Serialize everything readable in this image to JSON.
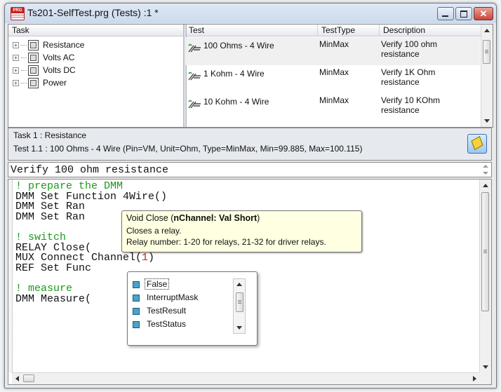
{
  "window": {
    "title": "Ts201-SelfTest.prg (Tests) :1 *",
    "app_icon_label": "PRG",
    "close_glyph": "✕"
  },
  "task_pane": {
    "header": "Task",
    "items": [
      {
        "label": "Resistance",
        "expander": "+"
      },
      {
        "label": "Volts AC",
        "expander": "+"
      },
      {
        "label": "Volts DC",
        "expander": "+"
      },
      {
        "label": "Power",
        "expander": "+"
      }
    ]
  },
  "test_pane": {
    "headers": {
      "test": "Test",
      "type": "TestType",
      "description": "Description"
    },
    "rows": [
      {
        "test": "100 Ohms - 4 Wire",
        "type": "MinMax",
        "description": "Verify 100 ohm resistance"
      },
      {
        "test": "1 Kohm - 4 Wire",
        "type": "MinMax",
        "description": "Verify 1K Ohm resistance"
      },
      {
        "test": "10 Kohm - 4 Wire",
        "type": "MinMax",
        "description": "Verify 10 KOhm resistance"
      }
    ]
  },
  "info_bar": {
    "task_line": "Task 1 : Resistance",
    "test_line": "Test 1.1 : 100 Ohms - 4 Wire (Pin=VM, Unit=Ohm, Type=MinMax, Min=99.885, Max=100.115)"
  },
  "description_line": "Verify 100 ohm resistance",
  "code": {
    "lines": [
      {
        "a": "! prepare the DMM",
        "b": "",
        "c": ""
      },
      {
        "a": "DMM Set Function 4Wire()",
        "b": "",
        "c": ""
      },
      {
        "a": "DMM Set Ran",
        "b": "",
        "c": ""
      },
      {
        "a": "DMM Set Ran",
        "b": "",
        "c": ""
      },
      {
        "a": "",
        "b": "",
        "c": ""
      },
      {
        "a": "! switch",
        "b": "",
        "c": ""
      },
      {
        "a": "RELAY Close(",
        "b": "",
        "c": ""
      },
      {
        "a": "MUX Connect Channel(",
        "b": "1",
        "c": ")"
      },
      {
        "a": "REF Set Func",
        "b": "",
        "c": ""
      },
      {
        "a": "",
        "b": "",
        "c": ""
      },
      {
        "a": "! measure",
        "b": "",
        "c": ""
      },
      {
        "a": "DMM Measure(",
        "b": "",
        "c": ""
      }
    ]
  },
  "tooltip": {
    "signature_prefix": "Void Close (",
    "signature_param": "nChannel: Val Short",
    "signature_suffix": ")",
    "line2": "Closes a relay.",
    "line3": "Relay number: 1-20 for relays, 21-32 for driver relays."
  },
  "autocomplete": {
    "items": [
      "False",
      "InterruptMask",
      "TestResult",
      "TestStatus"
    ],
    "selected": "False"
  },
  "colors": {
    "comment": "#1c9a1c",
    "number": "#d02020",
    "tooltip_bg": "#ffffe1",
    "close_button": "#c8453a"
  }
}
